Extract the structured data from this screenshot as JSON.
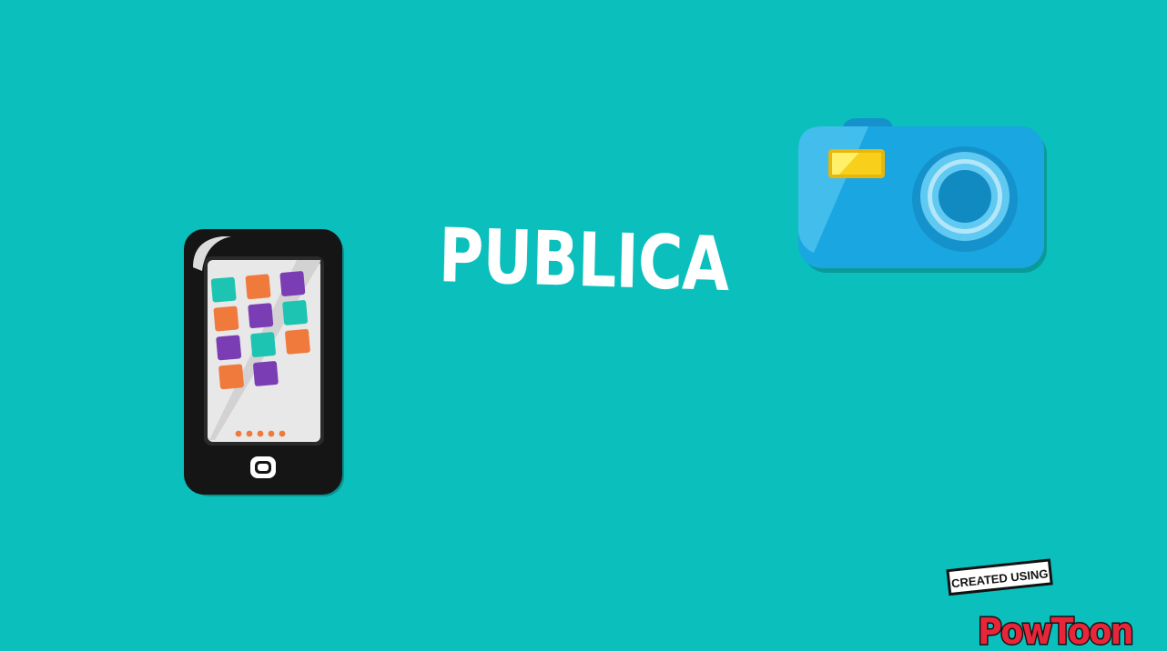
{
  "scene": {
    "background_color": "#0bbfbc",
    "title": "PUBLICA"
  },
  "phone": {
    "icon": "smartphone-icon",
    "body_color": "#1c1c1c",
    "screen_color": "#e6e6e6",
    "app_colors": [
      "#1ec4b2",
      "#f07a3c",
      "#7a3db3"
    ],
    "page_dots_color": "#f07a3c"
  },
  "camera": {
    "icon": "camera-icon",
    "body_color": "#1aa6e0",
    "flash_color": "#f8cf1a"
  },
  "watermark": {
    "top_text": "CREATED USING",
    "brand": "PowToon",
    "brand_color": "#e8263a"
  }
}
